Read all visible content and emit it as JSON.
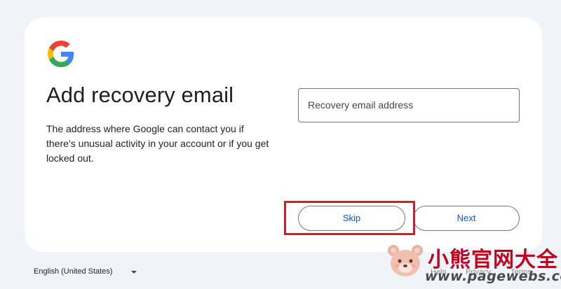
{
  "brand": {
    "logo_icon": "google-g-logo-icon"
  },
  "page": {
    "title": "Add recovery email",
    "description": "The address where Google can contact you if there’s unusual activity in your account or if you get locked out."
  },
  "form": {
    "email_placeholder": "Recovery email address"
  },
  "actions": {
    "skip_label": "Skip",
    "next_label": "Next"
  },
  "footer": {
    "language": "English (United States)",
    "links": [
      "Help",
      "Privacy",
      "Terms"
    ]
  },
  "watermark": {
    "name": "小熊官网大全",
    "url": "www.pagewebs.com"
  },
  "colors": {
    "background": "#f0f4f9",
    "card": "#ffffff",
    "accent": "#0b57d0",
    "highlight": "#e0162b"
  }
}
